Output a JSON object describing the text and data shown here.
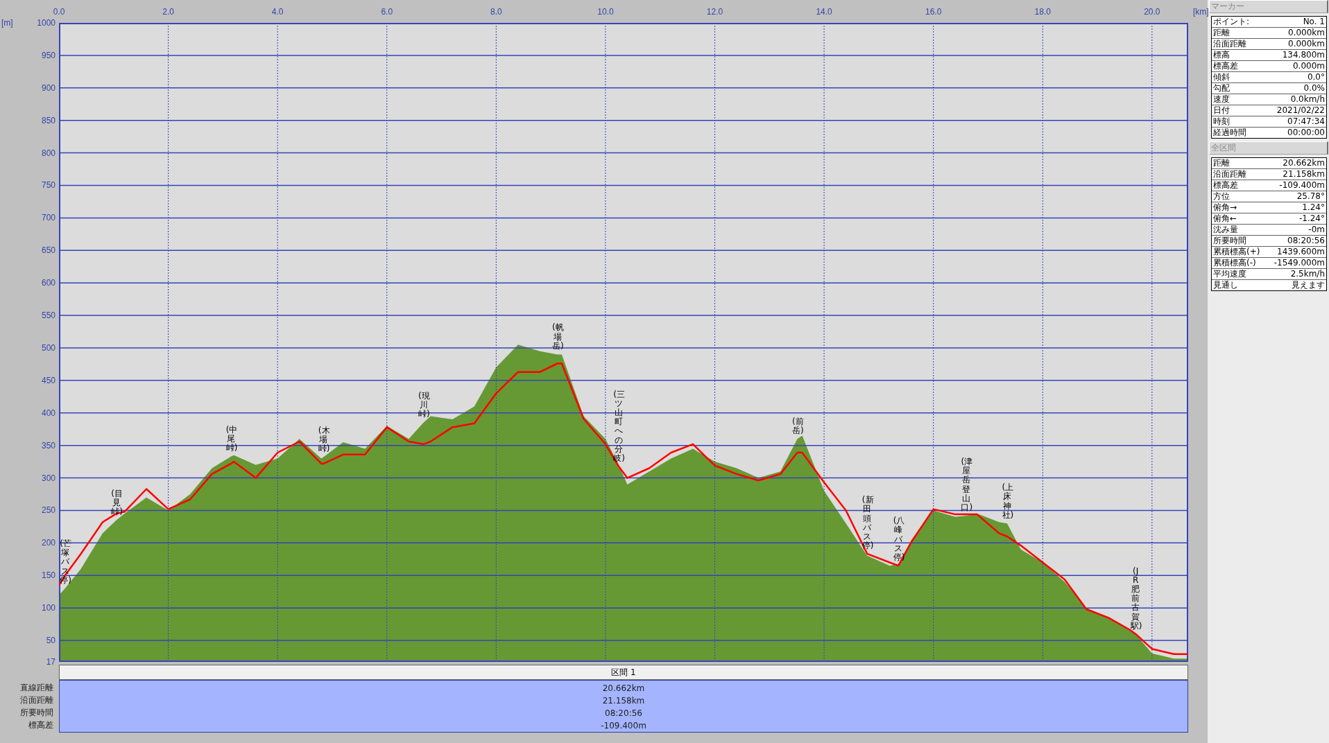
{
  "chart": {
    "x_unit": "[km]",
    "y_unit": "[m]",
    "chart_data": {
      "type": "area",
      "x": [
        0,
        0.11,
        0.4,
        0.8,
        1.05,
        1.2,
        1.6,
        2.0,
        2.4,
        2.8,
        3.15,
        3.2,
        3.6,
        4.0,
        4.4,
        4.8,
        4.84,
        5.2,
        5.6,
        6.0,
        6.4,
        6.67,
        6.8,
        7.2,
        7.6,
        8.0,
        8.4,
        8.8,
        9.12,
        9.2,
        9.6,
        10.0,
        10.24,
        10.4,
        10.8,
        11.2,
        11.6,
        12.0,
        12.4,
        12.8,
        13.2,
        13.51,
        13.6,
        14.0,
        14.4,
        14.79,
        14.8,
        15.2,
        15.36,
        15.6,
        16.0,
        16.4,
        16.6,
        16.8,
        17.2,
        17.35,
        17.6,
        18.0,
        18.4,
        18.8,
        19.2,
        19.6,
        19.7,
        20.0,
        20.4,
        20.662
      ],
      "series": [
        {
          "color": "#669933",
          "values": [
            120,
            130,
            160,
            215,
            235,
            245,
            270,
            250,
            275,
            315,
            333,
            335,
            320,
            330,
            360,
            330,
            332,
            355,
            345,
            380,
            360,
            385,
            395,
            390,
            410,
            470,
            505,
            495,
            490,
            490,
            395,
            360,
            320,
            290,
            310,
            330,
            345,
            325,
            315,
            300,
            310,
            360,
            365,
            280,
            230,
            180,
            180,
            165,
            168,
            205,
            250,
            240,
            242,
            245,
            232,
            230,
            190,
            170,
            140,
            100,
            85,
            65,
            60,
            30,
            22,
            22
          ]
        }
      ],
      "xlim": [
        0,
        20.662
      ],
      "ylim": [
        17,
        1000
      ],
      "grid": true,
      "xticks": [
        {
          "value": 0,
          "label": "0.0"
        },
        {
          "value": 2,
          "label": "2.0"
        },
        {
          "value": 4,
          "label": "4.0"
        },
        {
          "value": 6,
          "label": "6.0"
        },
        {
          "value": 8,
          "label": "8.0"
        },
        {
          "value": 10,
          "label": "10.0"
        },
        {
          "value": 12,
          "label": "12.0"
        },
        {
          "value": 14,
          "label": "14.0"
        },
        {
          "value": 16,
          "label": "16.0"
        },
        {
          "value": 18,
          "label": "18.0"
        },
        {
          "value": 20,
          "label": "20.0"
        }
      ],
      "yticks": [
        17,
        50,
        100,
        150,
        200,
        250,
        300,
        350,
        400,
        450,
        500,
        550,
        600,
        650,
        700,
        750,
        800,
        850,
        900,
        950,
        1000
      ],
      "annotations": [
        {
          "x": 0.11,
          "y": 130,
          "text": "(芒塚バス停)"
        },
        {
          "x": 1.05,
          "y": 235,
          "text": "(目見峠)"
        },
        {
          "x": 3.15,
          "y": 333,
          "text": "(中尾峠)"
        },
        {
          "x": 4.84,
          "y": 332,
          "text": "(木場峠)"
        },
        {
          "x": 6.67,
          "y": 385,
          "text": "(現川峠)"
        },
        {
          "x": 9.12,
          "y": 490,
          "text": "(帆場岳)"
        },
        {
          "x": 10.24,
          "y": 318,
          "text": "(三ツ山町への分岐)"
        },
        {
          "x": 13.51,
          "y": 360,
          "text": "(前岳)"
        },
        {
          "x": 14.79,
          "y": 183,
          "text": "(新田頭バス停)"
        },
        {
          "x": 15.36,
          "y": 165,
          "text": "(八峰バス停)"
        },
        {
          "x": 16.6,
          "y": 242,
          "text": "(津屋岳登山口)"
        },
        {
          "x": 17.35,
          "y": 230,
          "text": "(上床神社)"
        },
        {
          "x": 19.7,
          "y": 60,
          "text": "(JR肥前古賀駅)"
        }
      ]
    }
  },
  "track": {
    "chart_data": {
      "type": "line",
      "x": [
        0,
        0.11,
        0.4,
        0.8,
        1.05,
        1.2,
        1.6,
        2.0,
        2.4,
        2.8,
        3.15,
        3.2,
        3.6,
        4.0,
        4.4,
        4.8,
        4.84,
        5.2,
        5.6,
        6.0,
        6.4,
        6.67,
        6.8,
        7.2,
        7.6,
        8.0,
        8.4,
        8.8,
        9.12,
        9.2,
        9.6,
        10.0,
        10.24,
        10.4,
        10.8,
        11.2,
        11.6,
        12.0,
        12.4,
        12.8,
        13.2,
        13.51,
        13.6,
        14.0,
        14.4,
        14.79,
        14.8,
        15.2,
        15.36,
        15.6,
        16.0,
        16.4,
        16.6,
        16.8,
        17.2,
        17.35,
        17.6,
        18.0,
        18.4,
        18.8,
        19.2,
        19.6,
        19.7,
        20.0,
        20.4,
        20.662
      ],
      "series": [
        {
          "color": "#ff0000",
          "values": [
            135,
            150,
            183,
            232,
            245,
            248,
            283,
            252,
            267,
            306,
            322,
            325,
            300,
            339,
            356,
            322,
            322,
            336,
            336,
            378,
            356,
            352,
            356,
            378,
            384,
            430,
            463,
            463,
            476,
            476,
            391,
            352,
            318,
            300,
            315,
            339,
            352,
            319,
            306,
            296,
            306,
            339,
            339,
            293,
            250,
            183,
            183,
            170,
            165,
            202,
            252,
            244,
            244,
            244,
            215,
            210,
            196,
            170,
            144,
            98,
            85,
            66,
            60,
            37,
            29,
            29
          ]
        }
      ],
      "xlim": [
        0,
        20.662
      ],
      "ylim": [
        17,
        1000
      ]
    }
  },
  "section": {
    "header": "区間 1",
    "rows": [
      {
        "label": "直線距離",
        "value": "20.662km"
      },
      {
        "label": "沿面距離",
        "value": "21.158km"
      },
      {
        "label": "所要時間",
        "value": "08:20:56"
      },
      {
        "label": "標高差",
        "value": "-109.400m"
      }
    ]
  },
  "marker_panel": {
    "title": "マーカー",
    "rows": [
      {
        "label": "ポイント:",
        "value": "No. 1"
      },
      {
        "label": "距離",
        "value": "0.000km"
      },
      {
        "label": "沿面距離",
        "value": "0.000km"
      },
      {
        "label": "標高",
        "value": "134.800m"
      },
      {
        "label": "標高差",
        "value": "0.000m"
      },
      {
        "label": "傾斜",
        "value": "0.0°"
      },
      {
        "label": "勾配",
        "value": "0.0%"
      },
      {
        "label": "速度",
        "value": "0.0km/h"
      },
      {
        "label": "日付",
        "value": "2021/02/22"
      },
      {
        "label": "時刻",
        "value": "07:47:34"
      },
      {
        "label": "経過時間",
        "value": "00:00:00"
      }
    ]
  },
  "total_panel": {
    "title": "全区間",
    "rows": [
      {
        "label": "距離",
        "value": "20.662km"
      },
      {
        "label": "沿面距離",
        "value": "21.158km"
      },
      {
        "label": "標高差",
        "value": "-109.400m"
      },
      {
        "label": "方位",
        "value": "25.78°"
      },
      {
        "label": "俯角→",
        "value": "1.24°"
      },
      {
        "label": "俯角←",
        "value": "-1.24°"
      },
      {
        "label": "沈み量",
        "value": "-0m"
      },
      {
        "label": "所要時間",
        "value": "08:20:56"
      },
      {
        "label": "累積標高(+)",
        "value": "1439.600m"
      },
      {
        "label": "累積標高(-)",
        "value": "-1549.000m"
      },
      {
        "label": "平均速度",
        "value": "2.5km/h"
      },
      {
        "label": "見通し",
        "value": "見えます"
      }
    ]
  }
}
